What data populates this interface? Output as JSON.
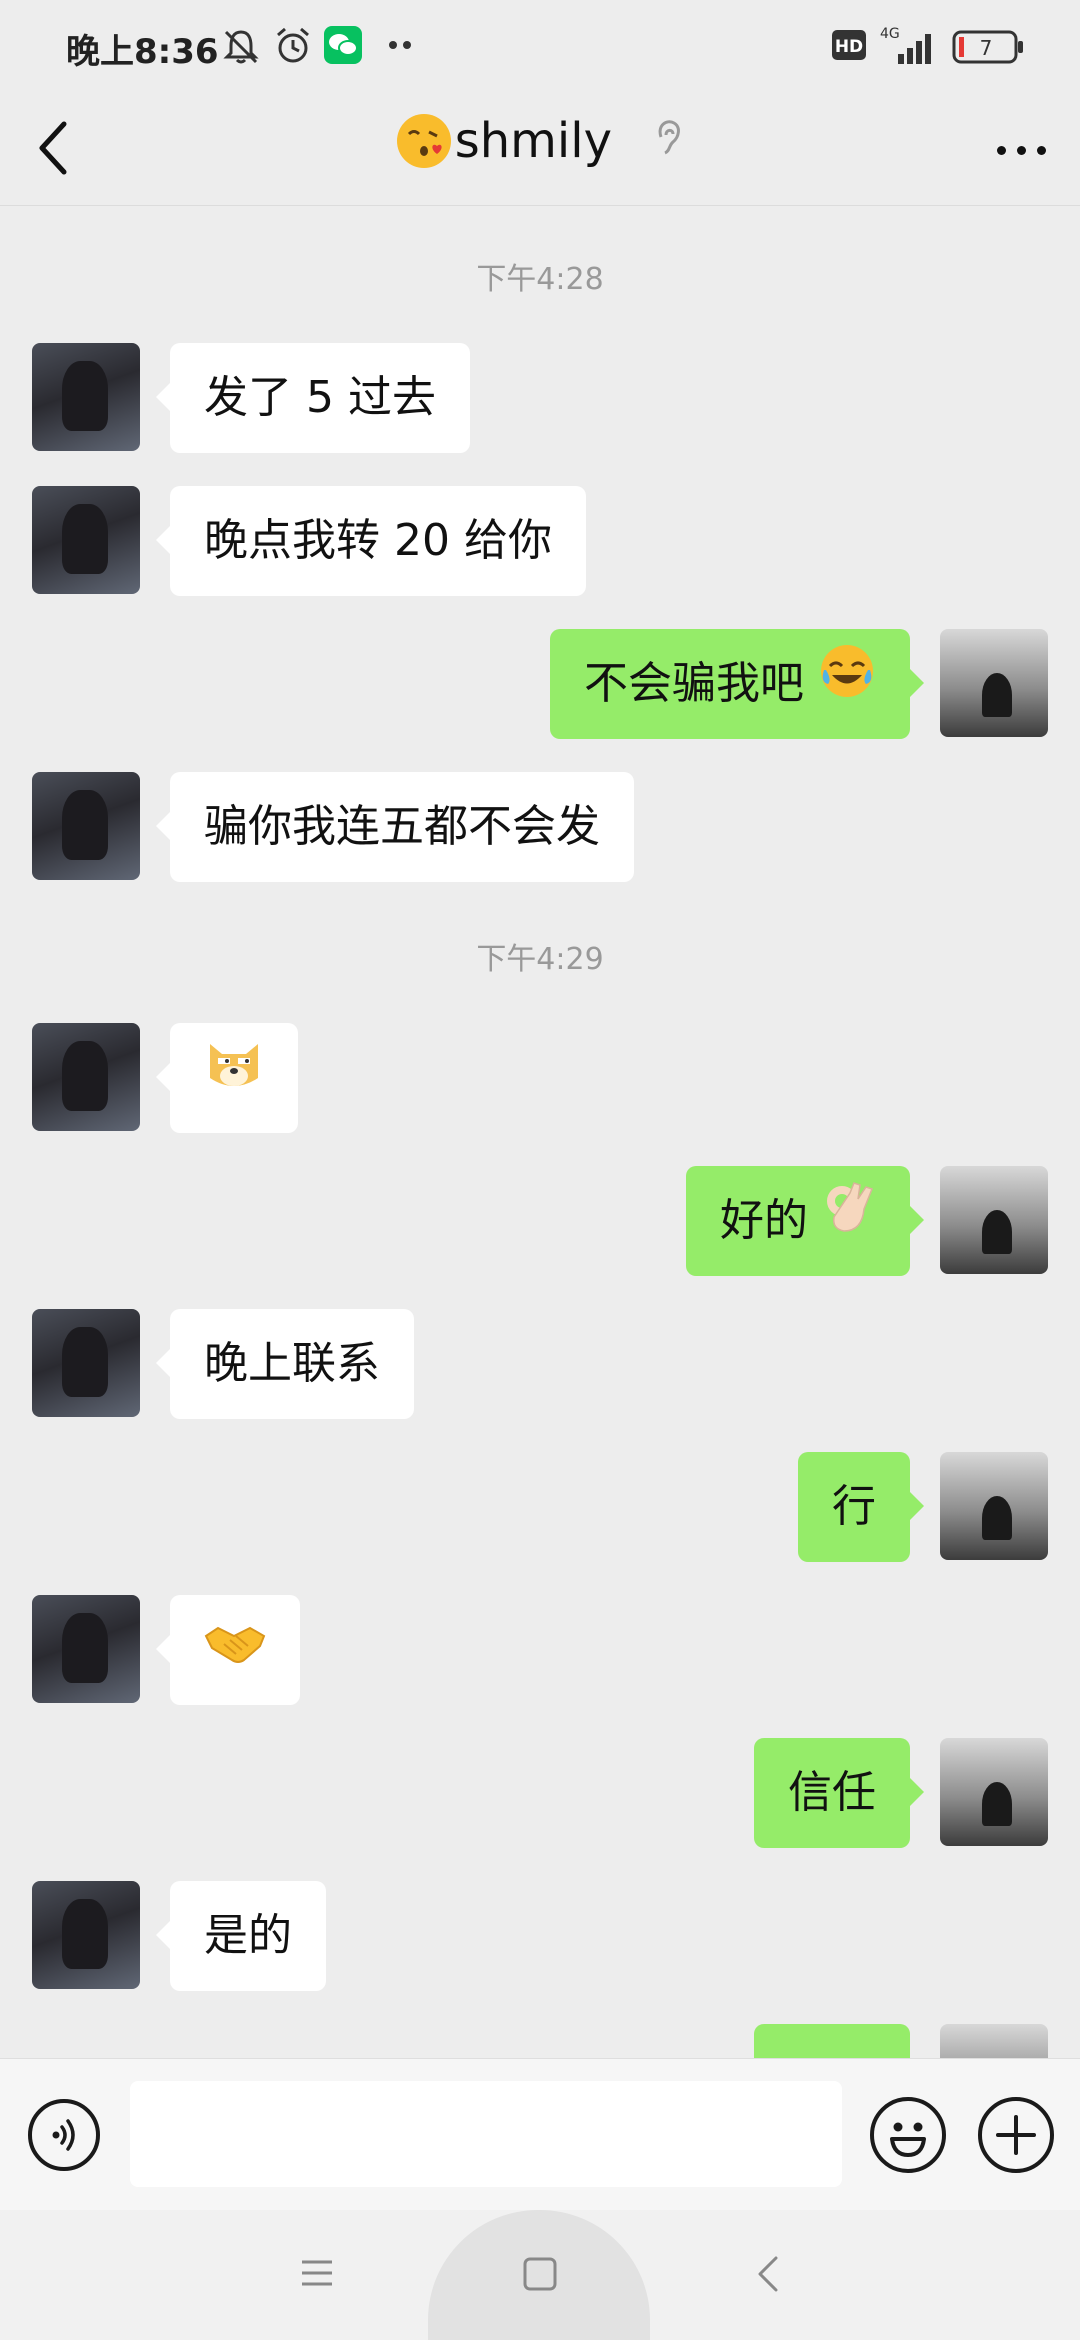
{
  "status_bar": {
    "time": "晚上8:36",
    "icons": [
      "mute-bell-icon",
      "alarm-icon",
      "wechat-icon",
      "more-dots-icon",
      "hd-icon",
      "4g-signal-icon",
      "battery-icon"
    ],
    "network": "4G",
    "hd": "HD",
    "battery": "7"
  },
  "header": {
    "title": "shmily",
    "title_emoji": "face-blowing-kiss",
    "icons": [
      "back-icon",
      "ear-icon",
      "more-icon"
    ]
  },
  "messages": [
    {
      "type": "time",
      "text": "下午4:28"
    },
    {
      "type": "msg",
      "side": "left",
      "text": "发了 5 过去"
    },
    {
      "type": "msg",
      "side": "left",
      "text": "晚点我转 20 给你"
    },
    {
      "type": "msg",
      "side": "right",
      "text": "不会骗我吧",
      "emoji": "laughing-crying-icon"
    },
    {
      "type": "msg",
      "side": "left",
      "text": "骗你我连五都不会发"
    },
    {
      "type": "time",
      "text": "下午4:29"
    },
    {
      "type": "msg",
      "side": "left",
      "text": "",
      "emoji": "doge-icon"
    },
    {
      "type": "msg",
      "side": "right",
      "text": "好的",
      "emoji": "ok-hand-icon"
    },
    {
      "type": "msg",
      "side": "left",
      "text": "晚上联系"
    },
    {
      "type": "msg",
      "side": "right",
      "text": "行"
    },
    {
      "type": "msg",
      "side": "left",
      "text": "",
      "emoji": "handshake-icon"
    },
    {
      "type": "msg",
      "side": "right",
      "text": "信任"
    },
    {
      "type": "msg",
      "side": "left",
      "text": "是的"
    }
  ],
  "input_bar": {
    "placeholder": "",
    "icons": [
      "voice-icon",
      "emoji-icon",
      "plus-icon"
    ]
  },
  "nav_bar": {
    "icons": [
      "menu-icon",
      "home-icon",
      "back-nav-icon"
    ]
  },
  "colors": {
    "background": "#ededed",
    "bubble_self": "#95ec69",
    "bubble_other": "#ffffff",
    "time_text": "#999999"
  }
}
